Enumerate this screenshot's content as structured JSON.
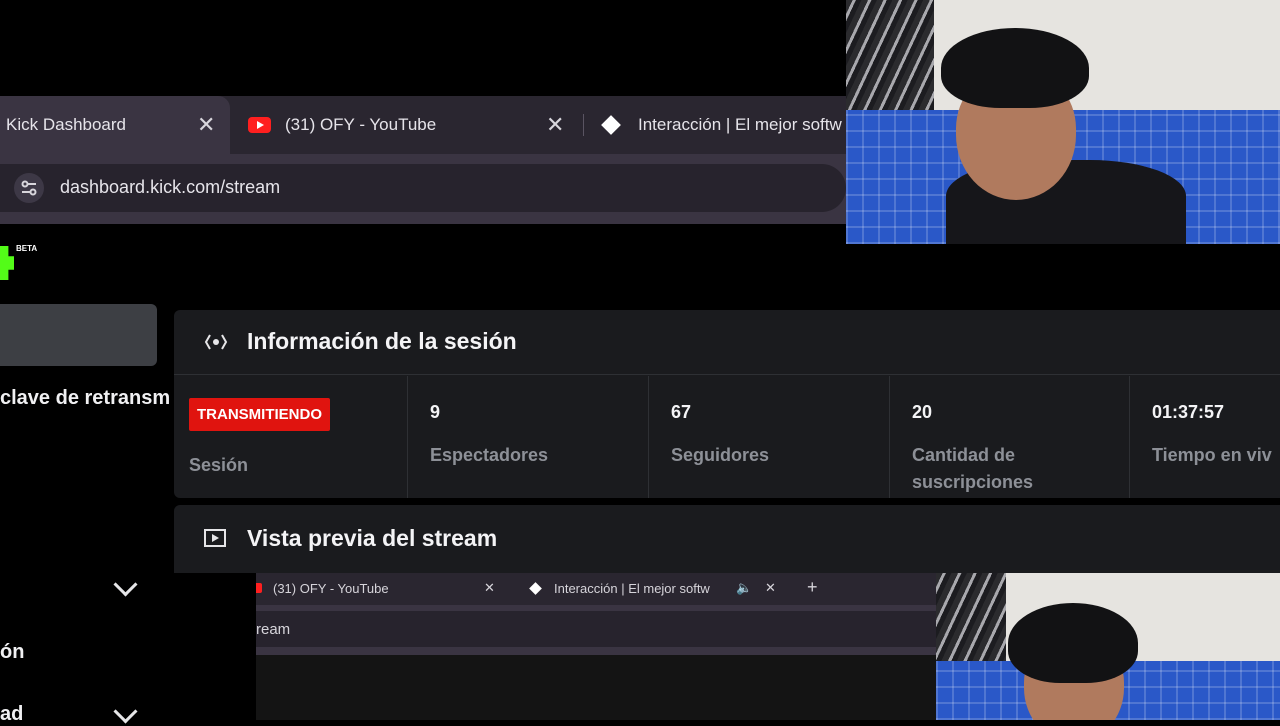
{
  "browser": {
    "tabs": [
      {
        "label": "Kick Dashboard",
        "active": true
      },
      {
        "label": "(31) OFY - YouTube",
        "icon": "youtube-icon"
      },
      {
        "label": "Interacción | El mejor softw",
        "icon": "diamond-icon"
      }
    ],
    "url": "dashboard.kick.com/stream"
  },
  "brand": {
    "badge": "BETA",
    "accent": "#53fc18"
  },
  "sidebar": {
    "items": [
      {
        "label": "clave de retransm"
      },
      {
        "label": "ón"
      },
      {
        "label": "ad"
      }
    ]
  },
  "session": {
    "title": "Información de la sesión",
    "status_badge": "TRANSMITIENDO",
    "status_label": "Sesión",
    "stats": [
      {
        "value": "9",
        "label": "Espectadores"
      },
      {
        "value": "67",
        "label": "Seguidores"
      },
      {
        "value": "20",
        "label": "Cantidad de",
        "label2": "suscripciones"
      },
      {
        "value": "01:37:57",
        "label": "Tiempo en viv"
      }
    ]
  },
  "preview": {
    "title": "Vista previa del stream",
    "mini_tabs": [
      {
        "label": "(31) OFY - YouTube"
      },
      {
        "label": "Interacción | El mejor softw"
      }
    ],
    "mini_url": "ream",
    "plus": "+"
  },
  "colors": {
    "live_red": "#e0140f",
    "panel": "#1a1b1e"
  }
}
